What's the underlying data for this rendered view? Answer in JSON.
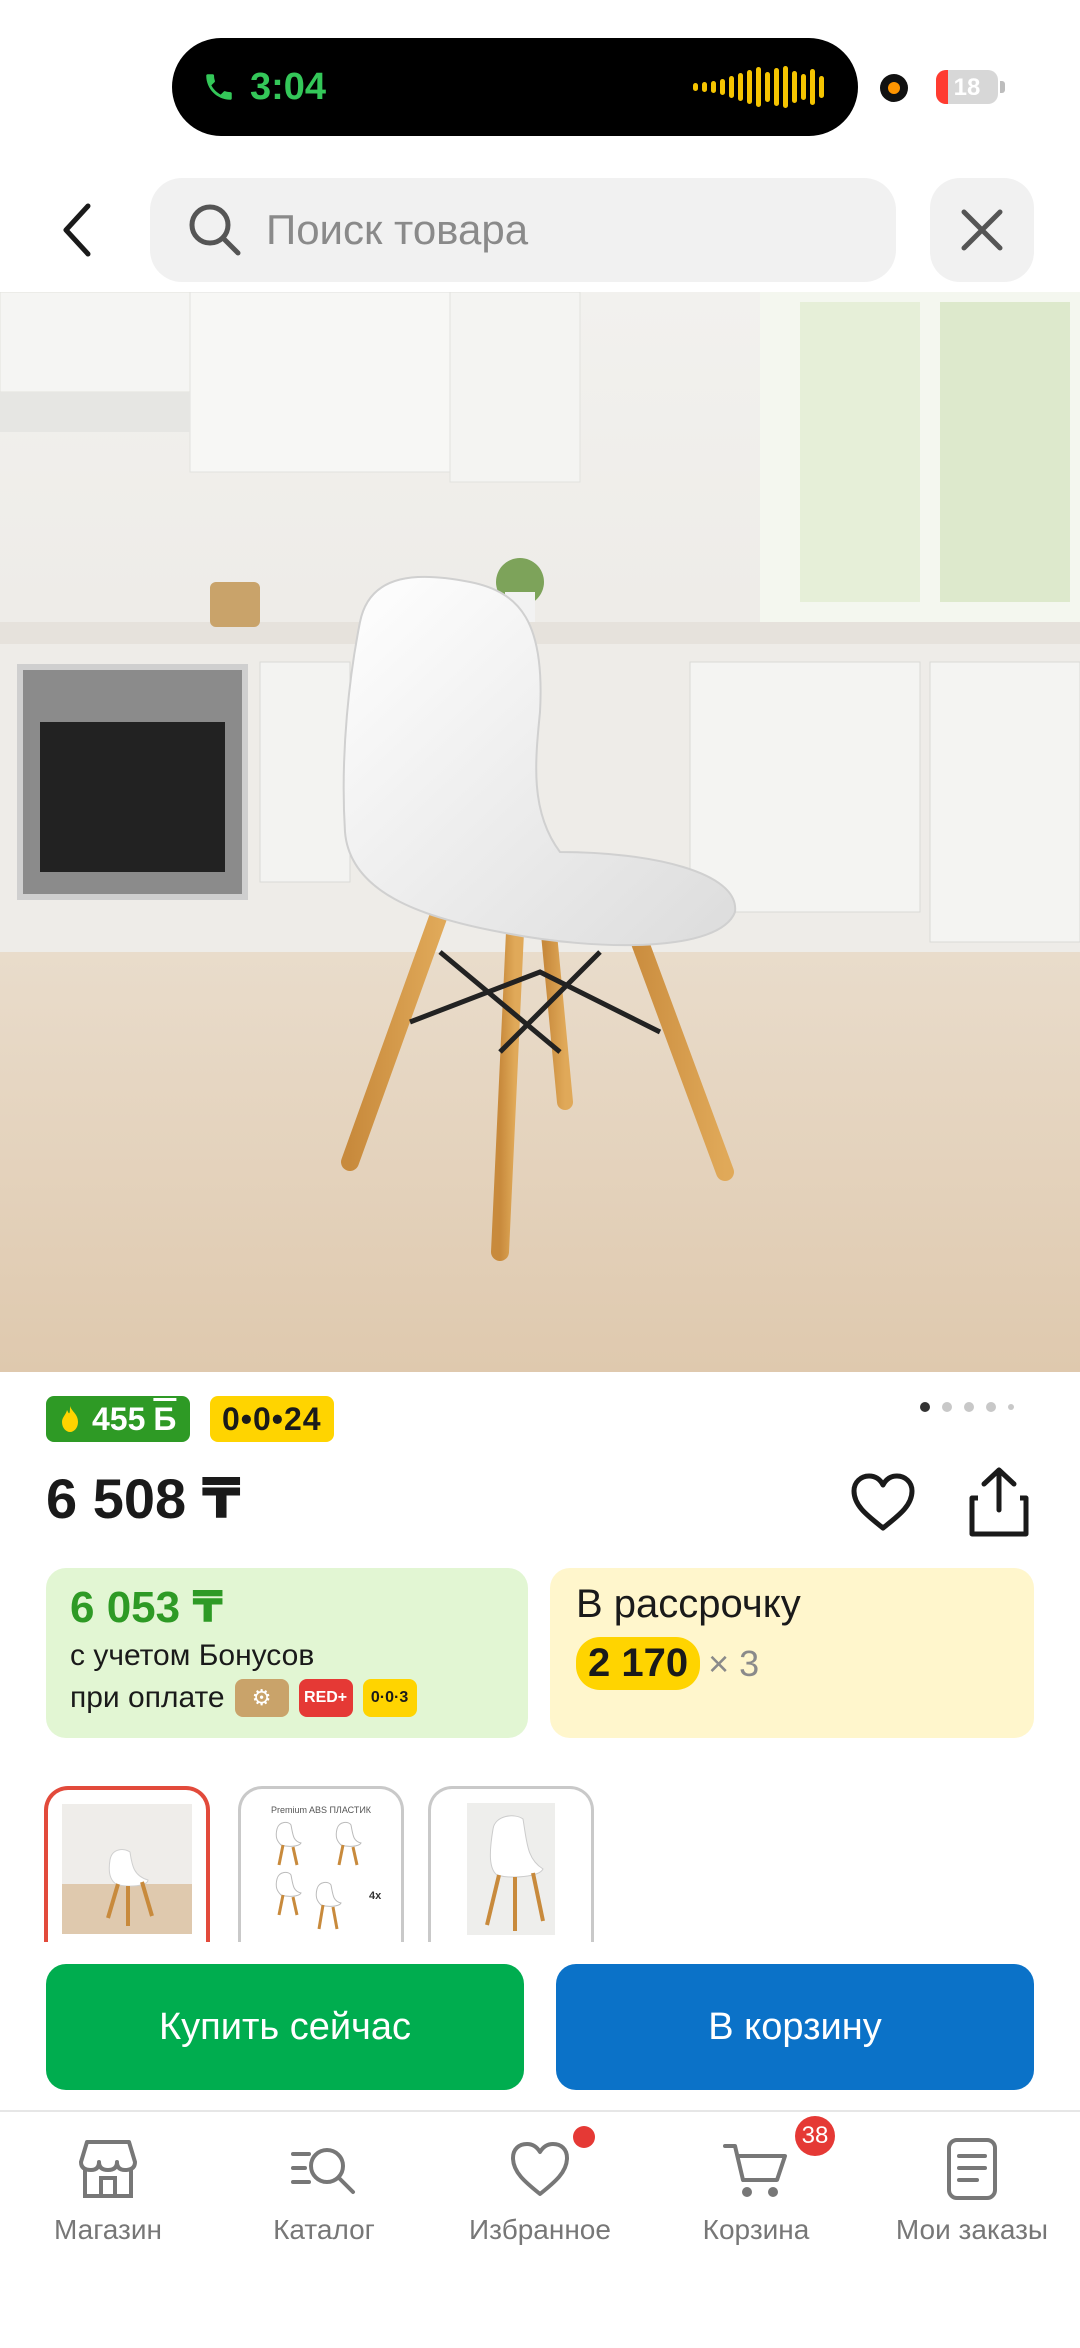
{
  "status_bar": {
    "time": "3:04",
    "battery": "18"
  },
  "search": {
    "placeholder": "Поиск товара"
  },
  "product": {
    "bonus_badge": "455",
    "bonus_badge_currency": "Б",
    "installment_badge": "0•0•24",
    "price": "6 508 ₸",
    "gallery_page": 1,
    "gallery_total": 5
  },
  "bonus_card": {
    "price": "6 053 ₸",
    "line1": "с учетом Бонусов",
    "line2": "при оплате",
    "pay_badges": [
      "RED+",
      "0·0·3"
    ]
  },
  "installment_card": {
    "title": "В рассрочку",
    "amount": "2 170",
    "multiplier": "× 3"
  },
  "thumbnail_texts": {
    "t2_caption": "Premium ABS ПЛАСТИК",
    "t2_count": "4x"
  },
  "actions": {
    "buy_now": "Купить сейчас",
    "add_to_cart": "В корзину"
  },
  "nav": {
    "items": [
      {
        "label": "Магазин",
        "icon": "store-icon"
      },
      {
        "label": "Каталог",
        "icon": "catalog-search-icon"
      },
      {
        "label": "Избранное",
        "icon": "heart-icon"
      },
      {
        "label": "Корзина",
        "icon": "cart-icon"
      },
      {
        "label": "Мои заказы",
        "icon": "orders-icon"
      }
    ],
    "cart_count": "38"
  },
  "colors": {
    "buy": "#00ad4f",
    "cart": "#0b72c8",
    "bonus_green": "#2e9a25",
    "installment_yellow": "#ffd400",
    "badge_red": "#e53935"
  }
}
